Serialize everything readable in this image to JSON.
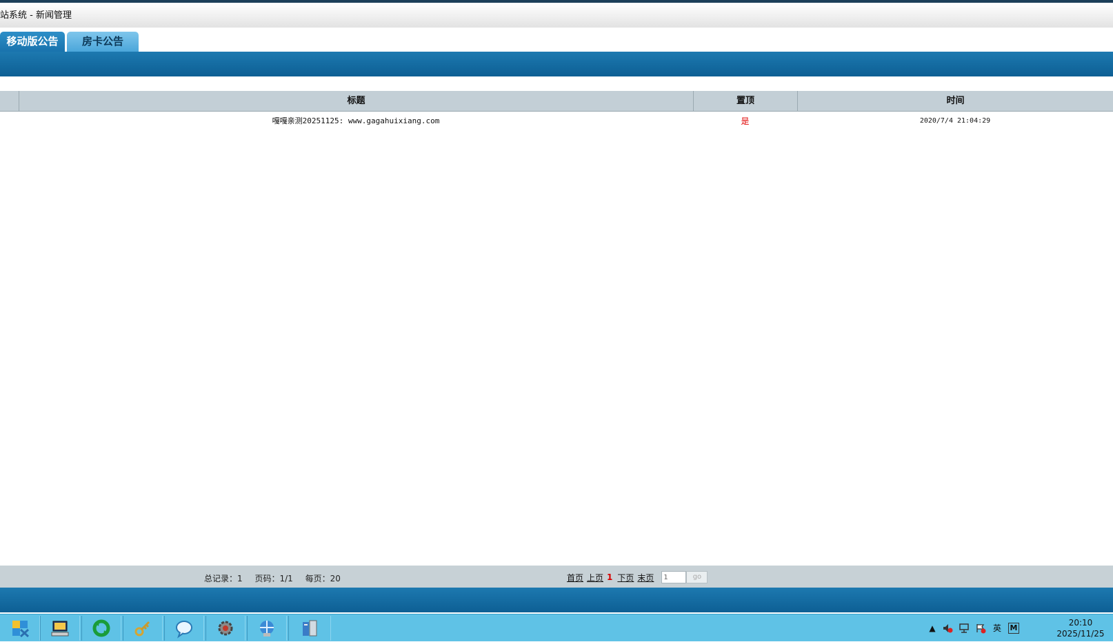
{
  "window": {
    "title": "站系统 - 新闻管理"
  },
  "tabs": [
    {
      "label": "移动版公告",
      "active": true
    },
    {
      "label": "房卡公告",
      "active": false
    }
  ],
  "table": {
    "headers": [
      "",
      "标题",
      "置顶",
      "时间"
    ],
    "rows": [
      {
        "title": "嘎嘎亲测20251125: www.gagahuixiang.com",
        "pinned": "是",
        "time": "2020/7/4 21:04:29"
      }
    ]
  },
  "pager": {
    "total_records": "总记录：1",
    "page_code": "页码：1/1",
    "per_page": "每页：20",
    "first": "首页",
    "prev": "上页",
    "current": "1",
    "next": "下页",
    "last": "末页",
    "input_value": "1",
    "go_label": "go"
  },
  "taskbar": {
    "apps": [
      "start-icon",
      "computer-icon",
      "recycle-icon",
      "key-icon",
      "chat-icon",
      "settings-gear-icon",
      "network-icon",
      "server-manager-icon"
    ],
    "tray": {
      "ime": "英",
      "ime_mode": "M"
    },
    "clock_time": "20:10",
    "clock_date": "2025/11/25"
  },
  "colors": {
    "band_blue": "#1367a0",
    "header_gray": "#c3cfd6",
    "pinned_red": "#e00000",
    "taskbar": "#5fc2e6"
  }
}
